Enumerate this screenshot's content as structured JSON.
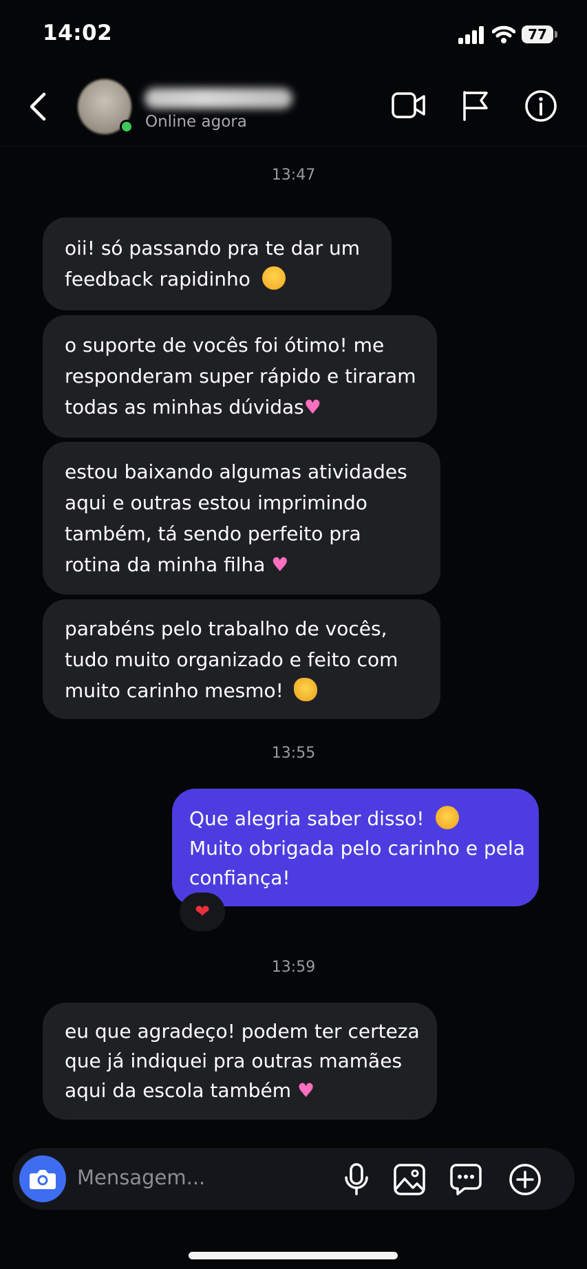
{
  "status_bar": {
    "time": "14:02",
    "battery": "77"
  },
  "header": {
    "username": "",
    "status": "Online agora",
    "icons": [
      "back-arrow-icon",
      "video-call-icon",
      "flag-icon",
      "info-icon"
    ]
  },
  "timestamps": [
    "13:47",
    "13:55",
    "13:59"
  ],
  "incoming": [
    {
      "lines": [
        "oii! só passando pra te dar um",
        "feedback rapidinho"
      ],
      "emoji": "smiling-face-emoji"
    },
    {
      "lines": [
        "o suporte de vocês foi ótimo! me",
        "responderam super rápido e tiraram",
        "todas as minhas dúvidas"
      ],
      "emoji": "heart-emoji"
    },
    {
      "lines": [
        "estou baixando algumas atividades",
        "aqui e outras estou imprimindo",
        "também, tá sendo perfeito pra",
        "rotina da minha filha"
      ],
      "emoji": "heart-emoji"
    },
    {
      "lines": [
        "parabéns pelo trabalho de vocês,",
        "tudo muito organizado e feito com",
        "muito carinho mesmo!"
      ],
      "emoji": "clapping-hands-emoji"
    },
    {
      "lines": [
        "eu que agradeço! podem ter certeza",
        "que já indiquei pra outras mamães",
        "aqui da escola também"
      ],
      "emoji": "heart-emoji"
    }
  ],
  "outgoing": {
    "lines": [
      "Que alegria saber disso!",
      "Muito obrigada pelo carinho e pela",
      "confiança!"
    ],
    "emoji": "smiling-face-with-hearts-emoji",
    "reaction": "❤"
  },
  "composer": {
    "placeholder": "Mensagem...",
    "icons": [
      "camera-icon",
      "microphone-icon",
      "gallery-icon",
      "chat-bubble-icon",
      "add-icon"
    ]
  },
  "colors": {
    "background": "#050608",
    "incoming_bubble": "#1f2024",
    "outgoing_bubble": "#4d3de0",
    "camera_button": "#3e6df2",
    "online": "#3ec85a"
  }
}
